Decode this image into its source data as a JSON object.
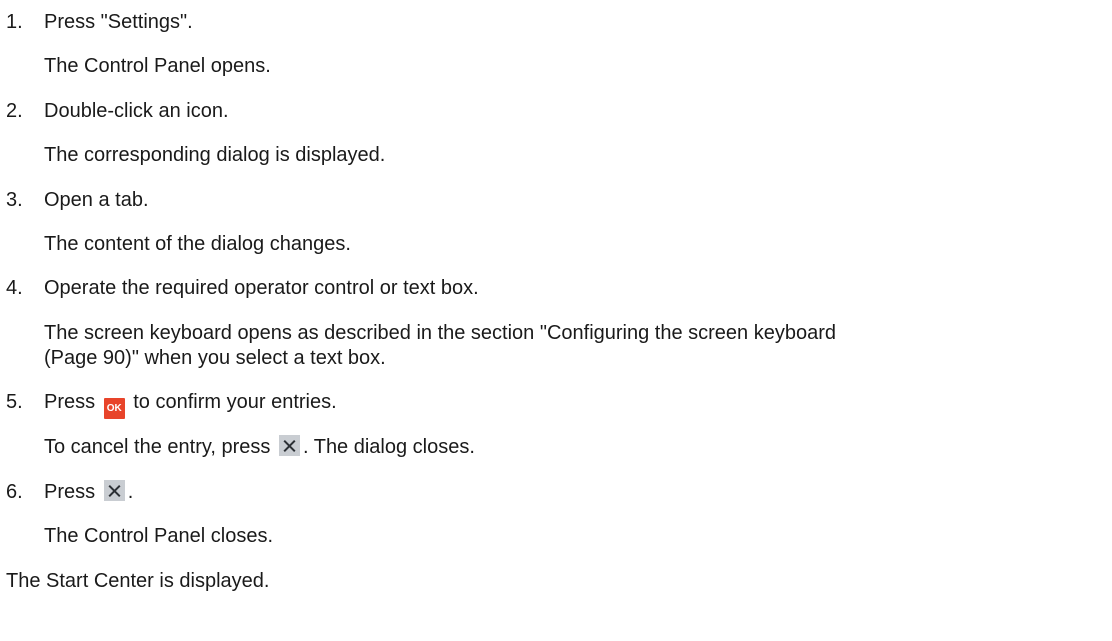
{
  "steps": [
    {
      "num": "1.",
      "instruction": "Press \"Settings\".",
      "result": "The Control Panel opens."
    },
    {
      "num": "2.",
      "instruction": "Double-click an icon.",
      "result": "The corresponding dialog is displayed."
    },
    {
      "num": "3.",
      "instruction": "Open a tab.",
      "result": "The content of the dialog changes."
    },
    {
      "num": "4.",
      "instruction": "Operate the required operator control or text box.",
      "result_line1": "The screen keyboard opens as described in the section \"Configuring the screen keyboard",
      "result_line2": "(Page 90)\" when you select a text box."
    },
    {
      "num": "5.",
      "instruction_before": "Press",
      "ok_icon_label": "OK",
      "instruction_after": "to confirm your entries.",
      "result_before": "To cancel the entry, press",
      "result_after": ". The dialog closes."
    },
    {
      "num": "6.",
      "instruction_before": "Press",
      "instruction_after": ".",
      "result": "The Control Panel closes."
    }
  ],
  "conclusion": "The Start Center is displayed.",
  "icons": {
    "ok": "ok-button-icon",
    "close": "close-x-icon"
  },
  "colors": {
    "ok_icon_bg": "#e8442a",
    "close_icon_bg": "#c9cdd2"
  }
}
